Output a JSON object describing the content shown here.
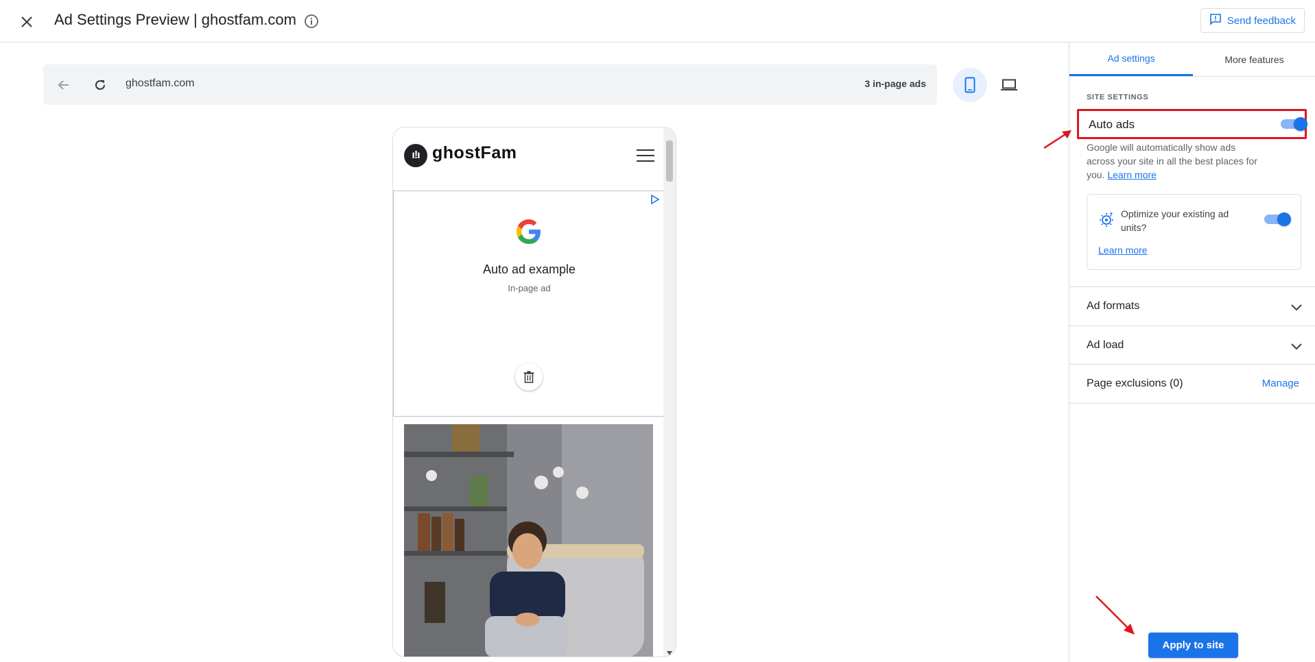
{
  "header": {
    "title": "Ad Settings Preview | ghostfam.com",
    "feedback_label": "Send feedback"
  },
  "preview": {
    "url": "ghostfam.com",
    "ad_count": "3 in-page ads"
  },
  "site": {
    "logo_mark": "ı!ı",
    "logo_text": "ghostFam"
  },
  "ad_example": {
    "title": "Auto ad example",
    "subtitle": "In-page ad"
  },
  "panel": {
    "tabs": [
      {
        "label": "Ad settings",
        "active": true
      },
      {
        "label": "More features",
        "active": false
      }
    ],
    "section_label": "SITE SETTINGS",
    "auto_ads": {
      "label": "Auto ads",
      "enabled": true,
      "description": "Google will automatically show ads across your site in all the best places for you.",
      "learn_more": "Learn more"
    },
    "optimize": {
      "label": "Optimize your existing ad units?",
      "enabled": true,
      "learn_more": "Learn more"
    },
    "ad_formats": "Ad formats",
    "ad_load": "Ad load",
    "page_exclusions": "Page exclusions (0)",
    "manage": "Manage",
    "apply": "Apply to site"
  },
  "colors": {
    "accent": "#1a73e8",
    "highlight": "#e0141e"
  },
  "icons": [
    "close-icon",
    "info-icon",
    "feedback-icon",
    "back-arrow-icon",
    "reload-icon",
    "mobile-device-icon",
    "desktop-device-icon",
    "hamburger-icon",
    "ad-choices-icon",
    "google-g-icon",
    "trash-icon",
    "optimize-gear-icon",
    "chevron-down-icon",
    "annotation-arrow"
  ]
}
